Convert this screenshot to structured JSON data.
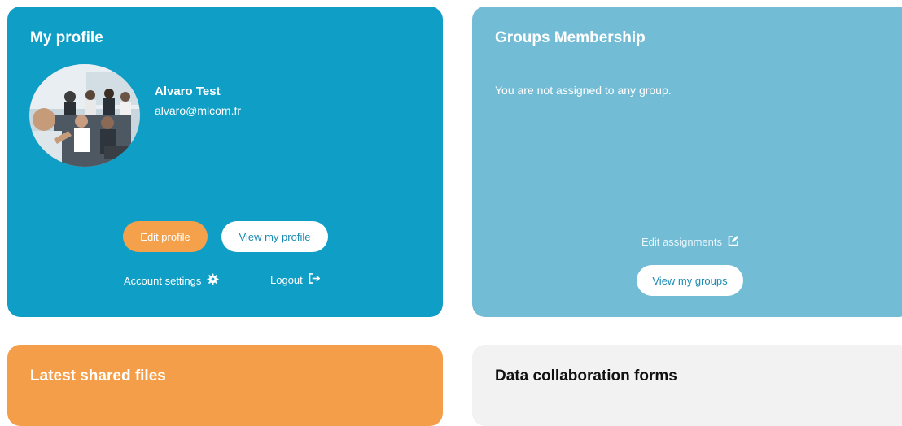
{
  "profile": {
    "title": "My profile",
    "user_name": "Alvaro Test",
    "user_email": "alvaro@mlcom.fr",
    "edit_profile_label": "Edit profile",
    "view_profile_label": "View my profile",
    "account_settings_label": "Account settings",
    "logout_label": "Logout",
    "icons": {
      "account_settings": "gear-icon",
      "logout": "logout-icon"
    }
  },
  "groups": {
    "title": "Groups Membership",
    "empty_message": "You are not assigned to any group.",
    "edit_assignments_label": "Edit assignments",
    "view_groups_label": "View my groups",
    "icons": {
      "edit_assignments": "edit-icon"
    }
  },
  "files": {
    "title": "Latest shared files"
  },
  "forms": {
    "title": "Data collaboration forms"
  },
  "colors": {
    "profile_card": "#0f9ec6",
    "groups_card": "#73bcd6",
    "files_card": "#f59e4a",
    "forms_card": "#f2f2f2",
    "accent_orange": "#f5a04b",
    "button_text_blue": "#1a8bb3"
  }
}
